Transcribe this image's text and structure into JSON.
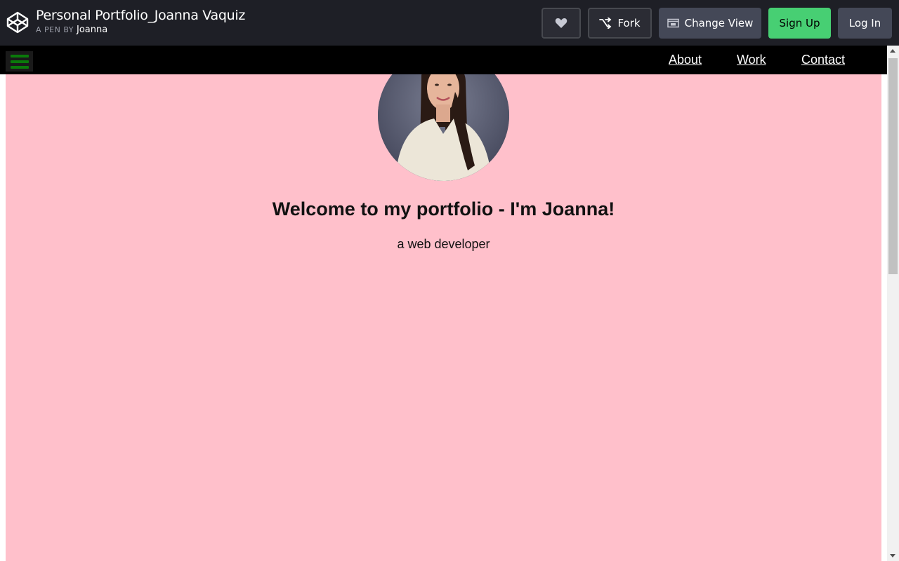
{
  "header": {
    "title": "Personal Portfolio_Joanna Vaquiz",
    "by_label": "A PEN BY",
    "author": "Joanna",
    "buttons": {
      "heart_icon": "heart-icon",
      "fork_label": "Fork",
      "change_view_label": "Change View",
      "sign_up_label": "Sign Up",
      "log_in_label": "Log In"
    },
    "colors": {
      "bar": "#1e1f26",
      "sign_up": "#47cf73",
      "button": "#444857"
    }
  },
  "preview": {
    "nav": {
      "menu_icon": "hamburger-menu-icon",
      "links": [
        "About",
        "Work",
        "Contact"
      ]
    },
    "hero": {
      "welcome": "Welcome to my portfolio - I'm Joanna!",
      "tagline": "a web developer"
    },
    "colors": {
      "background": "#ffc0cb",
      "nav": "#000000",
      "menu_icon": "#0a7a0a"
    }
  }
}
